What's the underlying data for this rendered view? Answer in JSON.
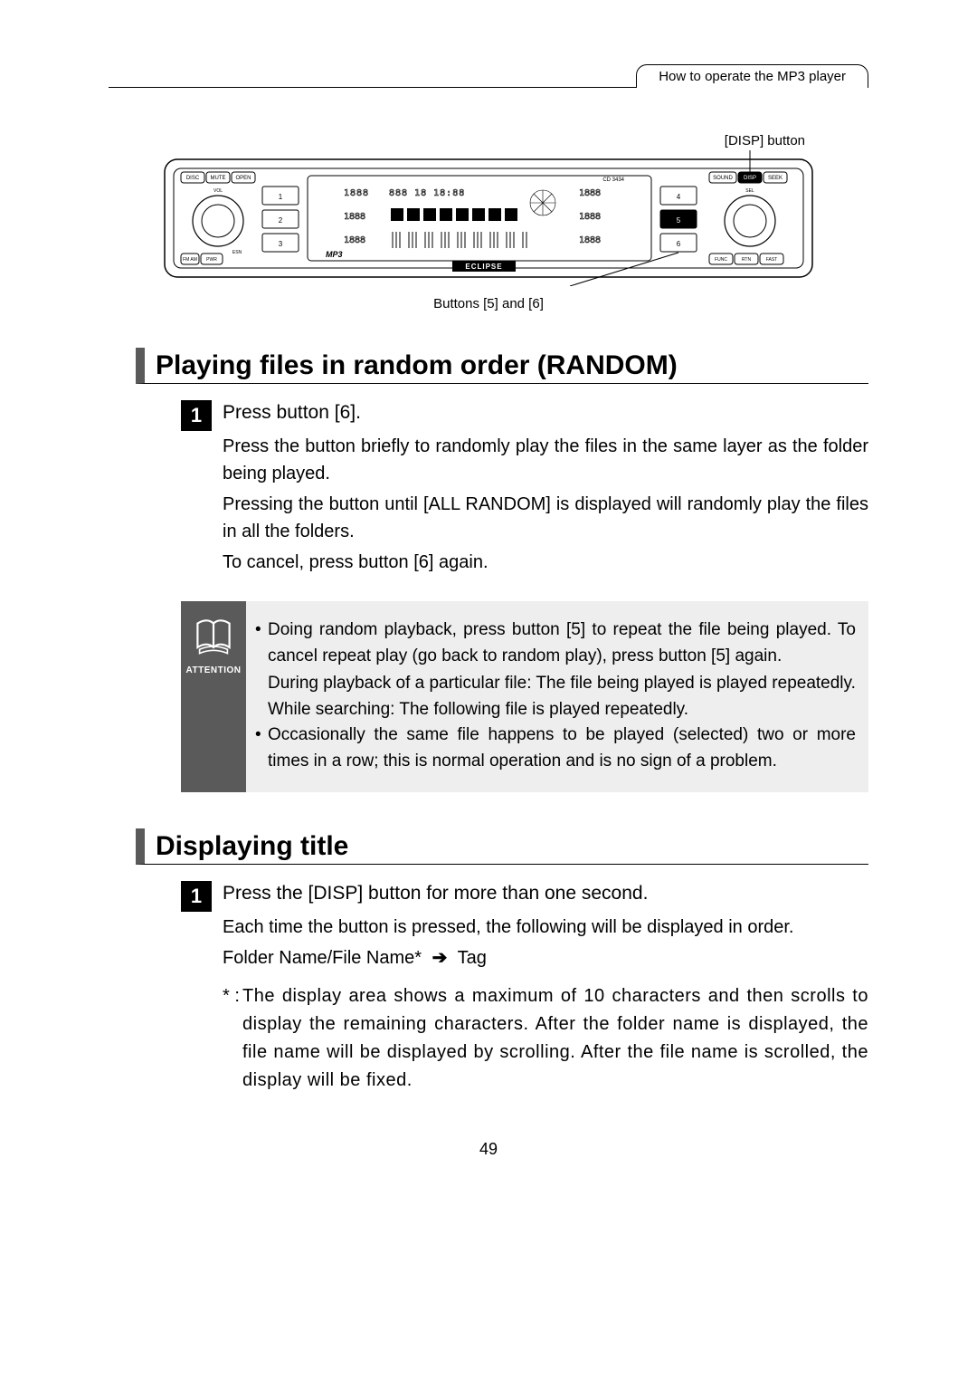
{
  "header": {
    "tab": "How to operate the MP3 player"
  },
  "diagram": {
    "disp_label": "[DISP] button",
    "buttons_caption": "Buttons [5] and [6]",
    "model": "CD 3434",
    "brand": "ECLIPSE",
    "btn_labels": {
      "disc": "DISC",
      "mute": "MUTE",
      "open": "OPEN",
      "sound": "SOUND",
      "disp": "DISP",
      "seek": "SEEK",
      "func": "FUNC",
      "rtn": "RTN",
      "fast": "FAST",
      "fmam": "FM AM",
      "pwr": "PWR",
      "esn": "ESN",
      "vol": "VOL",
      "sel": "SEL",
      "mp3": "MP3"
    },
    "nums": {
      "1": "1",
      "2": "2",
      "3": "3",
      "4": "4",
      "5": "5",
      "6": "6"
    }
  },
  "section_random": {
    "heading": "Playing files in random order (RANDOM)",
    "step_num": "1",
    "step_title": "Press button [6].",
    "p1": "Press the button briefly to randomly play the files in the same layer as the folder being played.",
    "p2": "Pressing the button until [ALL RANDOM] is displayed will randomly play the files in all the folders.",
    "p3": "To cancel, press button [6] again.",
    "attention_label": "ATTENTION",
    "a1": "Doing random playback, press button [5] to repeat the file being played. To cancel repeat play (go back to random play), press button [5] again.",
    "a1b": "During playback of a particular file: The file being played is played repeatedly.",
    "a1c": "While searching: The following file is played repeatedly.",
    "a2": "Occasionally the same file happens to be played (selected) two or more times in a row; this is normal operation and is no sign of a problem."
  },
  "section_title": {
    "heading": "Displaying title",
    "step_num": "1",
    "step_title": "Press the [DISP] button for more than one second.",
    "p1": "Each time the button is pressed, the following will be displayed in order.",
    "seq_a": "Folder Name/File Name*",
    "seq_b": "Tag",
    "footnote_star": "* :",
    "footnote": "The display area shows a maximum of 10 characters and then scrolls to display the remaining characters. After the folder name is displayed, the file name will be displayed by scrolling. After the file name is scrolled, the display will be fixed."
  },
  "page_number": "49"
}
